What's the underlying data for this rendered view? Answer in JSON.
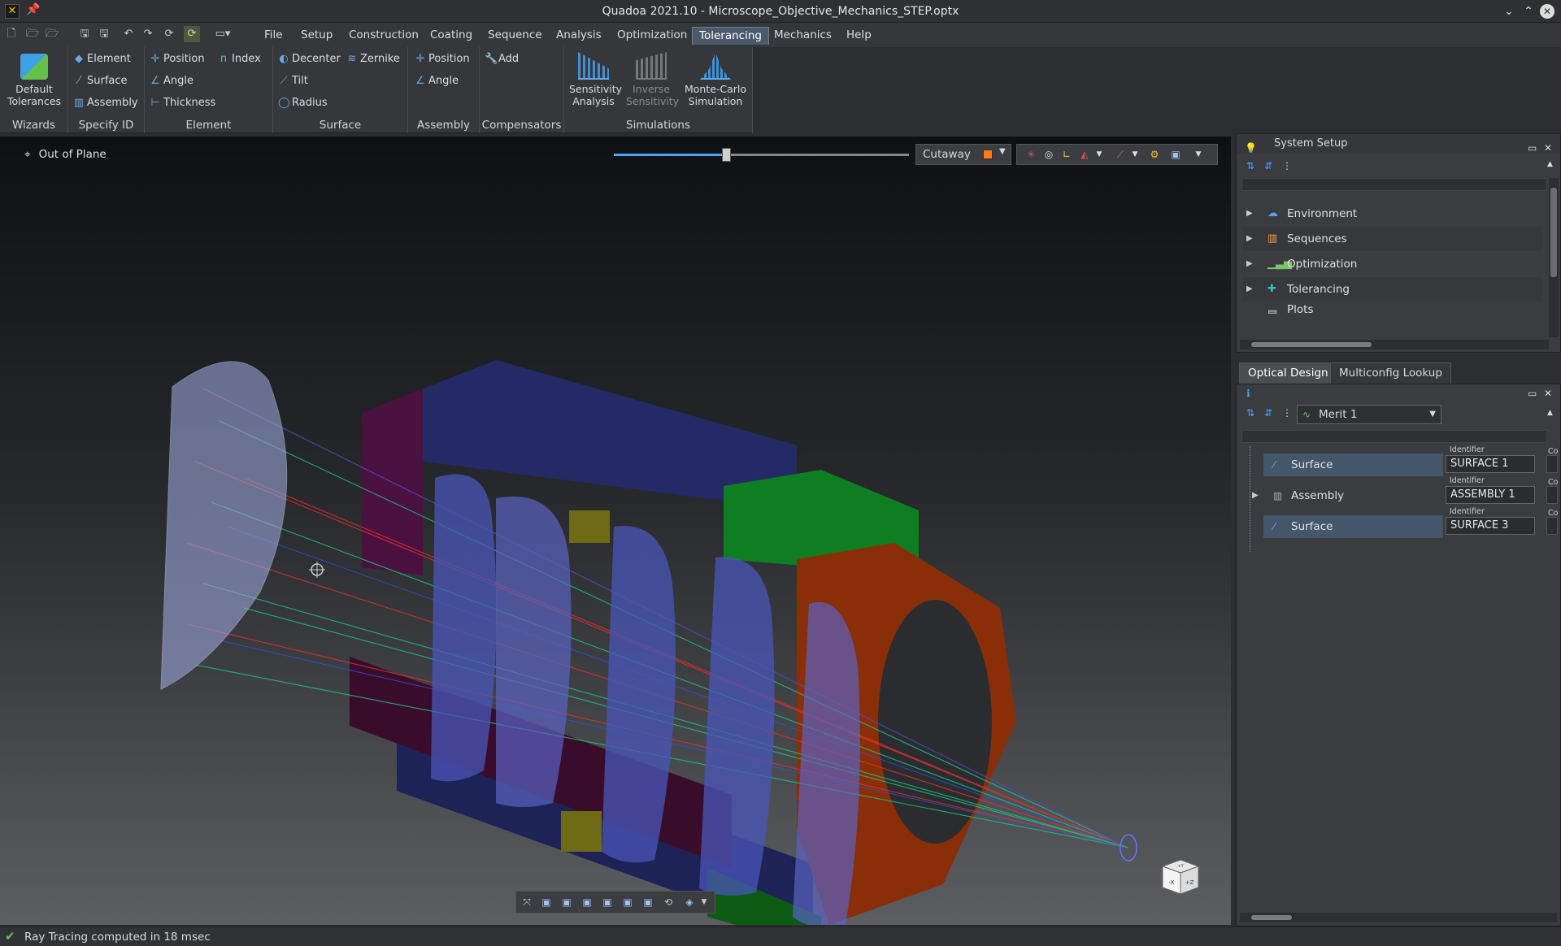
{
  "window": {
    "title": "Quadoa 2021.10 - Microscope_Objective_Mechanics_STEP.optx"
  },
  "menu": [
    "File",
    "Setup",
    "Construction",
    "Coating",
    "Sequence",
    "Analysis",
    "Optimization",
    "Tolerancing",
    "Mechanics",
    "Help"
  ],
  "menu_active": "Tolerancing",
  "ribbon": {
    "wizards": {
      "label": "Wizards",
      "default_tolerances": [
        "Default",
        "Tolerances"
      ]
    },
    "specify_id": {
      "label": "Specify ID",
      "items": [
        "Element",
        "Surface",
        "Assembly"
      ]
    },
    "element": {
      "label": "Element",
      "items": [
        "Position",
        "Angle",
        "Thickness",
        "Index"
      ]
    },
    "surface": {
      "label": "Surface",
      "items": [
        "Decenter",
        "Tilt",
        "Radius",
        "Zernike"
      ]
    },
    "assembly": {
      "label": "Assembly",
      "items": [
        "Position",
        "Angle"
      ]
    },
    "compensators": {
      "label": "Compensators",
      "items": [
        "Add"
      ]
    },
    "simulations": {
      "label": "Simulations",
      "sensitivity": [
        "Sensitivity",
        "Analysis"
      ],
      "inverse": [
        "Inverse",
        "Sensitivity"
      ],
      "montecarlo": [
        "Monte-Carlo",
        "Simulation"
      ]
    }
  },
  "viewport": {
    "mode_label": "Out of Plane",
    "slider_value": 0.38,
    "cutaway_label": "Cutaway",
    "cutaway_color": "#ff7a1a",
    "cube_faces": {
      "front": "-X",
      "right": "+Z",
      "top": "+Y"
    }
  },
  "system_setup": {
    "title": "System Setup",
    "items": [
      {
        "label": "Environment",
        "icon": "cloud-icon"
      },
      {
        "label": "Sequences",
        "icon": "sequences-icon"
      },
      {
        "label": "Optimization",
        "icon": "bar-chart-icon"
      },
      {
        "label": "Tolerancing",
        "icon": "puzzle-icon"
      },
      {
        "label": "Plots",
        "icon": "plots-icon"
      }
    ]
  },
  "optical_design": {
    "tabs": [
      "Optical Design",
      "Multiconfig Lookup"
    ],
    "merit_selected": "Merit 1",
    "identifier_caption": "Identifier",
    "co_caption": "Co",
    "rows": [
      {
        "label": "Surface",
        "id": "SURFACE 1"
      },
      {
        "label": "Assembly",
        "id": "ASSEMBLY 1"
      },
      {
        "label": "Surface",
        "id": "SURFACE 3"
      }
    ]
  },
  "status": {
    "text": "Ray Tracing computed in 18 msec"
  },
  "colors": {
    "accent": "#4aa3ff",
    "active_tab": "#4a5a6b"
  }
}
